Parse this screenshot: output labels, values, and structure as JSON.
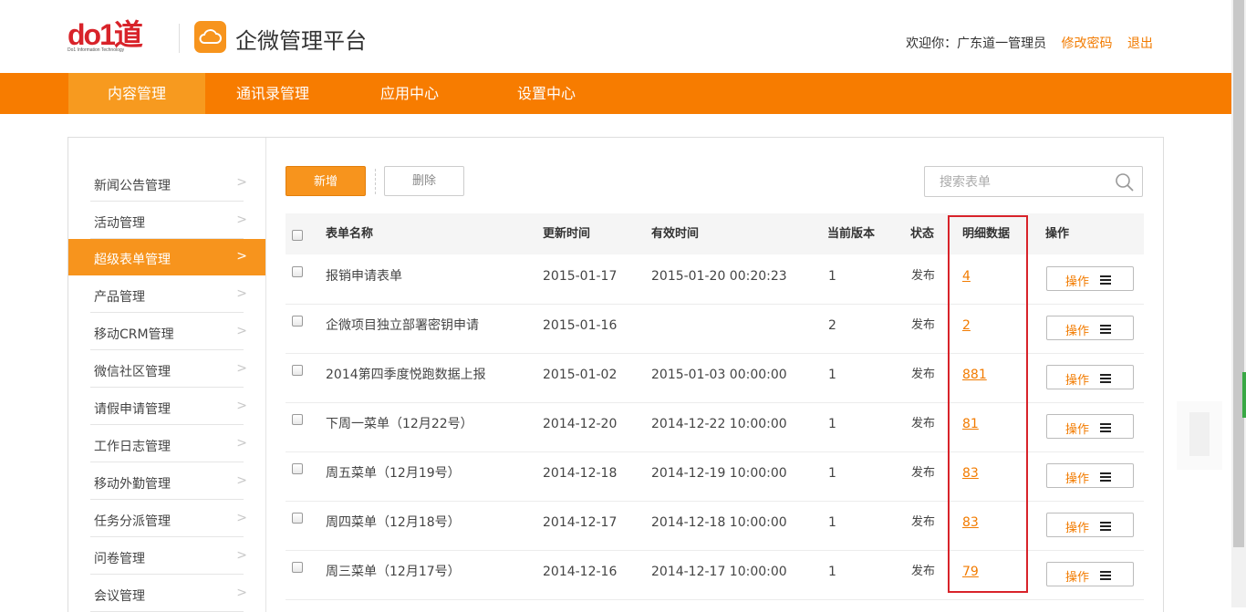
{
  "header": {
    "logo_brand": "do1道",
    "logo_sub": "Do1 Information Technology",
    "platform_title": "企微管理平台",
    "welcome": "欢迎你：广东道一管理员",
    "change_password": "修改密码",
    "logout": "退出"
  },
  "nav": {
    "items": [
      "内容管理",
      "通讯录管理",
      "应用中心",
      "设置中心"
    ],
    "active_index": 0
  },
  "sidebar": {
    "items": [
      "新闻公告管理",
      "活动管理",
      "超级表单管理",
      "产品管理",
      "移动CRM管理",
      "微信社区管理",
      "请假申请管理",
      "工作日志管理",
      "移动外勤管理",
      "任务分派管理",
      "问卷管理",
      "会议管理"
    ],
    "active_index": 2,
    "chevron": ">"
  },
  "toolbar": {
    "add_label": "新增",
    "delete_label": "删除",
    "search_placeholder": "搜索表单"
  },
  "table": {
    "headers": {
      "name": "表单名称",
      "updated": "更新时间",
      "valid": "有效时间",
      "version": "当前版本",
      "status": "状态",
      "detail": "明细数据",
      "action": "操作"
    },
    "rows": [
      {
        "name": "报销申请表单",
        "updated": "2015-01-17",
        "valid": "2015-01-20 00:20:23",
        "version": "1",
        "status": "发布",
        "detail": "4",
        "action": "操作"
      },
      {
        "name": "企微项目独立部署密钥申请",
        "updated": "2015-01-16",
        "valid": "",
        "version": "2",
        "status": "发布",
        "detail": "2",
        "action": "操作"
      },
      {
        "name": "2014第四季度悦跑数据上报",
        "updated": "2015-01-02",
        "valid": "2015-01-03 00:00:00",
        "version": "1",
        "status": "发布",
        "detail": "881",
        "action": "操作"
      },
      {
        "name": "下周一菜单（12月22号）",
        "updated": "2014-12-20",
        "valid": "2014-12-22 10:00:00",
        "version": "1",
        "status": "发布",
        "detail": "81",
        "action": "操作"
      },
      {
        "name": "周五菜单（12月19号）",
        "updated": "2014-12-18",
        "valid": "2014-12-19 10:00:00",
        "version": "1",
        "status": "发布",
        "detail": "83",
        "action": "操作"
      },
      {
        "name": "周四菜单（12月18号）",
        "updated": "2014-12-17",
        "valid": "2014-12-18 10:00:00",
        "version": "1",
        "status": "发布",
        "detail": "83",
        "action": "操作"
      },
      {
        "name": "周三菜单（12月17号）",
        "updated": "2014-12-16",
        "valid": "2014-12-17 10:00:00",
        "version": "1",
        "status": "发布",
        "detail": "79",
        "action": "操作"
      }
    ]
  },
  "colors": {
    "brand_orange": "#f77c00",
    "nav_active": "#f79a1f",
    "logo_red": "#d8232a",
    "highlight_red": "#d8232a"
  },
  "icons": {
    "cloud": "cloud-icon",
    "search": "search-icon",
    "menu": "menu-icon",
    "chevron": "chevron-right-icon"
  }
}
